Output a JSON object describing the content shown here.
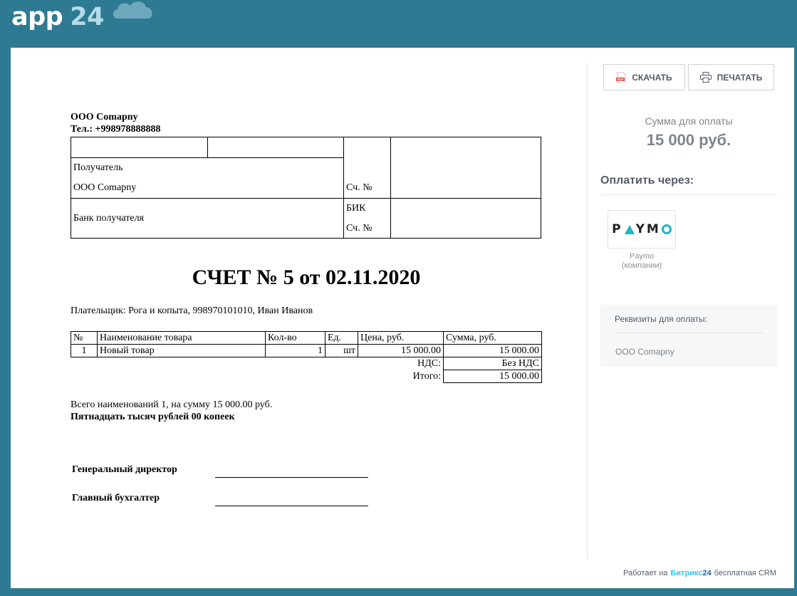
{
  "header": {
    "logo_app": "app",
    "logo_num": "24"
  },
  "toolbar": {
    "download_label": "СКАЧАТЬ",
    "print_label": "ПЕЧАТАТЬ"
  },
  "invoice": {
    "company_name": "ООО Comapny",
    "company_phone": "Тел.: +998978888888",
    "bank_table": {
      "recipient_label": "Получатель",
      "recipient_value": "ООО Comapny",
      "account_label": "Сч. №",
      "bank_label": "Банк получателя",
      "bik_label": "БИК",
      "account2_label": "Сч. №"
    },
    "title": "СЧЕТ № 5 от 02.11.2020",
    "payer": "Плательщик: Рога и копыта, 998970101010, Иван Иванов",
    "items_table": {
      "headers": [
        "№",
        "Наименование товара",
        "Кол-во",
        "Ед.",
        "Цена, руб.",
        "Сумма, руб."
      ],
      "rows": [
        [
          "1",
          "Новый товар",
          "1",
          "шт",
          "15 000.00",
          "15 000.00"
        ]
      ],
      "vat_label": "НДС:",
      "vat_value": "Без НДС",
      "total_label": "Итого:",
      "total_value": "15 000.00"
    },
    "total_line": "Всего наименований 1, на сумму 15 000.00 руб.",
    "total_words": "Пятнадцать тысяч рублей 00 копеек",
    "director_label": "Генеральный директор",
    "accountant_label": "Главный бухгалтер"
  },
  "sidebar": {
    "sum_label": "Сумма для оплаты",
    "sum_value": "15 000 руб.",
    "pay_via": "Оплатить через:",
    "pay_systems": [
      {
        "logo_text": "PAYMO",
        "name_line1": "Paymo",
        "name_line2": "(компании)"
      }
    ],
    "requisites_title": "Реквизиты для оплаты:",
    "requisites_value": "ООО Comapny"
  },
  "footer": {
    "prefix": "Работает на",
    "brand_main": "Битрикс",
    "brand_num": "24",
    "suffix": "бесплатная CRM"
  },
  "colors": {
    "background": "#2f7a93",
    "card": "#ffffff",
    "paymo_accent": "#1bb6c6",
    "bitrix_blue": "#2fc6f6"
  }
}
